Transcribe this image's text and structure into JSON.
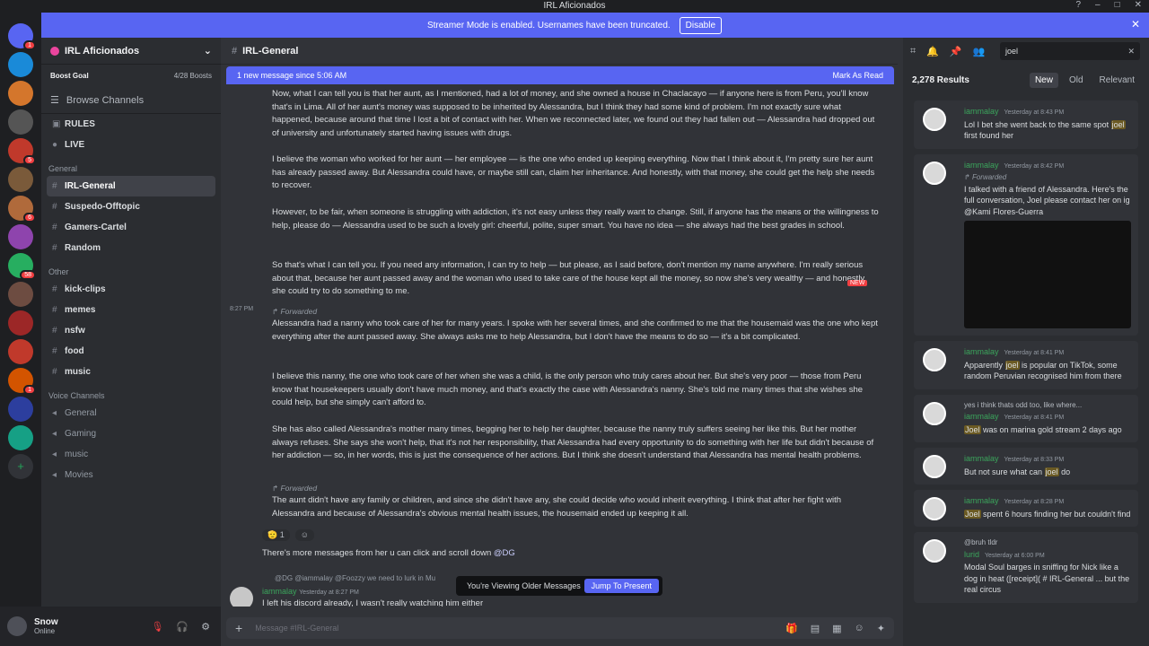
{
  "window": {
    "title": "IRL Aficionados"
  },
  "notice": {
    "text": "Streamer Mode is enabled. Usernames have been truncated.",
    "button": "Disable"
  },
  "servers": [
    {
      "badge": "1"
    },
    {
      "badge": ""
    },
    {
      "badge": ""
    },
    {
      "badge": ""
    },
    {
      "badge": "5"
    },
    {
      "badge": ""
    },
    {
      "badge": "6"
    },
    {
      "badge": ""
    },
    {
      "badge": "58"
    },
    {
      "badge": ""
    },
    {
      "badge": ""
    },
    {
      "badge": ""
    },
    {
      "badge": "1"
    },
    {
      "badge": ""
    },
    {
      "badge": ""
    }
  ],
  "guild": {
    "name": "IRL Aficionados",
    "boost_label": "Boost Goal",
    "boost_count": "4/28 Boosts",
    "browse": "Browse Channels"
  },
  "channels": {
    "top": [
      {
        "name": "RULES"
      },
      {
        "name": "LIVE"
      }
    ],
    "cat_general": "General",
    "general": [
      {
        "name": "IRL-General"
      },
      {
        "name": "Suspedo-Offtopic"
      },
      {
        "name": "Gamers-Cartel"
      },
      {
        "name": "Random"
      }
    ],
    "cat_other": "Other",
    "other": [
      {
        "name": "kick-clips"
      },
      {
        "name": "memes"
      },
      {
        "name": "nsfw"
      },
      {
        "name": "food"
      },
      {
        "name": "music"
      }
    ],
    "cat_voice": "Voice Channels",
    "voice": [
      {
        "name": "General"
      },
      {
        "name": "Gaming"
      },
      {
        "name": "music"
      },
      {
        "name": "Movies"
      }
    ]
  },
  "user": {
    "name": "Snow",
    "status": "Online"
  },
  "header": {
    "channel": "IRL-General"
  },
  "newbar": {
    "text": "1 new message since 5:06 AM",
    "action": "Mark As Read"
  },
  "messages": {
    "p1": "Now, what I can tell you is that her aunt, as I mentioned, had a lot of money, and she owned a house in Chaclacayo — if anyone here is from Peru, you'll know that's in Lima. All of her aunt's money was supposed to be inherited by Alessandra, but I think they had some kind of problem. I'm not exactly sure what happened, because around that time I lost a bit of contact with her. When we reconnected later, we found out they had fallen out — Alessandra had dropped out of university and unfortunately started having issues with drugs.",
    "p2": "I believe the woman who worked for her aunt — her employee — is the one who ended up keeping everything. Now that I think about it, I'm pretty sure her aunt has already passed away. But Alessandra could have, or maybe still can, claim her inheritance. And honestly, with that money, she could get the help she needs to recover.",
    "p3": "However, to be fair, when someone is struggling with addiction, it's not easy unless they really want to change. Still, if anyone has the means or the willingness to help, please do — Alessandra used to be such a lovely girl: cheerful, polite, super smart. You have no idea — she always had the best grades in school.",
    "p4": "So that's what I can tell you. If you need any information, I can try to help — but please, as I said before, don't mention my name anywhere. I'm really serious about that, because her aunt passed away and the woman who used to take care of the house kept all the money, so now she's very wealthy — and honestly, she could try to do something to me.",
    "new_tag": "NEW",
    "time": "8:27 PM",
    "forwarded": "Forwarded",
    "p5": "Alessandra had a nanny who took care of her for many years. I spoke with her several times, and she confirmed to me that the housemaid was the one who kept everything after the aunt passed away. She always asks me to help Alessandra, but I don't have the means to do so — it's a bit complicated.",
    "p6": "I believe this nanny, the one who took care of her when she was a child, is the only person who truly cares about her. But she's very poor — those from Peru know that housekeepers usually don't have much money, and that's exactly the case with Alessandra's nanny. She's told me many times that she wishes she could help, but she simply can't afford to.",
    "p7": "She has also called Alessandra's mother many times, begging her to help her daughter, because the nanny truly suffers seeing her like this. But her mother always refuses. She says she won't help, that it's not her responsibility, that Alessandra had every opportunity to do something with her life but didn't because of her addiction — so, in her words, this is just the consequence of her actions. But I think she doesn't understand that Alessandra has mental health problems.",
    "p8": "The aunt didn't have any family or children, and since she didn't have any, she could decide who would inherit everything. I think that after her fight with Alessandra and because of Alessandra's obvious mental health issues, the housemaid ended up keeping it all.",
    "react_count": "1",
    "p9": "There's more messages from her u can click and scroll down",
    "p9_mention": "@DG",
    "reply_preview": "@DG @iammalay @Foozzy we need to lurk in Mu",
    "last_user": "iammalay",
    "last_time": "Yesterday at 8:27 PM",
    "last_text": "I left his discord already, I wasn't really watching him either"
  },
  "toast": {
    "text": "You're Viewing Older Messages",
    "button": "Jump To Present"
  },
  "composer": {
    "placeholder": "Message #IRL-General"
  },
  "search": {
    "query": "joel",
    "results_count": "2,278 Results",
    "tabs": [
      "New",
      "Old",
      "Relevant"
    ]
  },
  "results": [
    {
      "user": "iammalay",
      "time": "Yesterday at 8:43 PM",
      "pre": "Lol I bet she went back to the same spot ",
      "hl": "joel",
      "post": " first found her"
    },
    {
      "user": "iammalay",
      "time": "Yesterday at 8:42 PM",
      "fwd": "Forwarded",
      "pre": "I talked with a friend of Alessandra. Here's the full conversation, Joel please contact her on ig @Kami Flores-Guerra",
      "hl": "",
      "post": ""
    },
    {
      "user": "iammalay",
      "time": "Yesterday at 8:41 PM",
      "pre": "Apparently ",
      "hl": "joel",
      "post": " is popular on TikTok, some random Peruvian recognised him from there"
    },
    {
      "user": "iammalay",
      "time": "Yesterday at 8:41 PM",
      "reply": "yes i think thats odd too, like where...",
      "pre": "",
      "hl": "Joel",
      "post": " was on marina gold stream 2 days ago"
    },
    {
      "user": "iammalay",
      "time": "Yesterday at 8:33 PM",
      "pre": "But not sure what can ",
      "hl": "joel",
      "post": " do"
    },
    {
      "user": "iammalay",
      "time": "Yesterday at 8:28 PM",
      "pre": "",
      "hl": "Joel",
      "post": " spent 6 hours finding her but couldn't find"
    },
    {
      "user": "lurid",
      "time": "Yesterday at 6:00 PM",
      "reply": "@bruh tldr",
      "pre": "Modal Soul barges in sniffing for Nick like a dog in heat ([receipt]( # IRL-General ... but the real circus",
      "hl": "",
      "post": ""
    }
  ]
}
